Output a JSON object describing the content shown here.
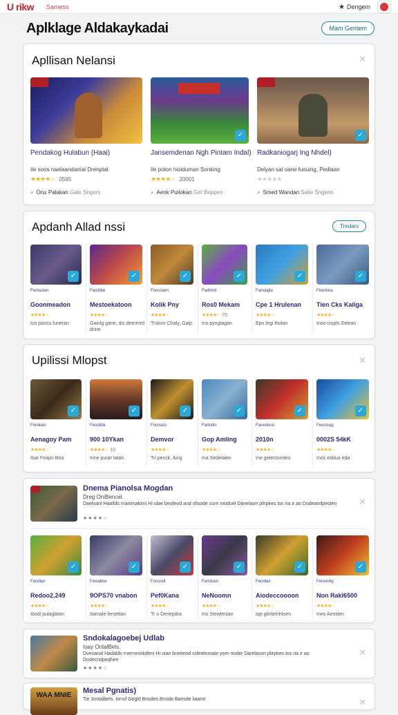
{
  "topbar": {
    "logo": "U rikw",
    "nav": "Samess",
    "user_label": "Dengem"
  },
  "header": {
    "title": "Aplklage Aldakaykadai",
    "button": "Mam Gentem"
  },
  "section1": {
    "title": "Apllisan Nelansi",
    "items": [
      {
        "title": "Pendakog Hulabun (Haai)",
        "desc": "Ile soos naelaandamal Drenptal.",
        "stars": "★★★★☆",
        "meta": "0595",
        "link": "Onu Palakan",
        "link_meta": "Gale Sngers"
      },
      {
        "title": "Jansemdenan Ngh Pintam Indal)",
        "desc": "Ile poton hiolduman Sonking",
        "stars": "★★★★☆",
        "meta": "20001",
        "link": "Aenk Puiiokan",
        "link_meta": "Get Boppen"
      },
      {
        "title": "Radkaniogarj Ing Nhdel)",
        "desc": "Delyan sal oane fuouing, Pedlaan",
        "stars": "★★★★★",
        "meta": "",
        "link": "Smed Wandan",
        "link_meta": "Salie Sngens"
      }
    ]
  },
  "section2": {
    "title": "Apdanh Allad nssi",
    "pill": "Tredani",
    "items": [
      {
        "cat": "Fenlasian",
        "title": "Goonmeadon",
        "stars": "★★★★☆",
        "meta": "",
        "desc": "Ios paosu funeran"
      },
      {
        "cat": "Fandrbe",
        "title": "Mestoekatoon",
        "stars": "★★★★☆",
        "meta": "",
        "desc": "Gainlg gane, dis deerrnrd drine"
      },
      {
        "cat": "Fonvslam",
        "title": "Kolik Pny",
        "stars": "★★★★☆",
        "meta": "",
        "desc": "Trulonr Chaly, Gaip"
      },
      {
        "cat": "Fadtimit",
        "title": "Ros0 Mekam",
        "stars": "★★★★☆",
        "meta": "70",
        "desc": "Ins pyngtagan"
      },
      {
        "cat": "Famaigla",
        "title": "Cpe 1 Hrulenan",
        "stars": "★★★★☆",
        "meta": "",
        "desc": "Epo legi tholan"
      },
      {
        "cat": "Fearlnoa",
        "title": "Tien Cks Kailga",
        "stars": "★★★★☆",
        "meta": "",
        "desc": "Inos-ciopls Selean"
      }
    ]
  },
  "section3": {
    "title": "Upilissi Mlopst",
    "items": [
      {
        "cat": "Fonikian",
        "title": "Aenagoy Pam",
        "stars": "★★★★☆",
        "meta": "",
        "desc": "Ibar Feapn Bea"
      },
      {
        "cat": "Fendiibk",
        "title": "900 10Ykan",
        "stars": "★★★★☆",
        "meta": "10",
        "desc": "Irine purar tatan"
      },
      {
        "cat": "Fonvsen",
        "title": "Demvor",
        "stars": "★★★★☆",
        "meta": "",
        "desc": "Tri pecck, Aing"
      },
      {
        "cat": "Farbldin",
        "title": "Gop Amling",
        "stars": "★★★★☆",
        "meta": "",
        "desc": "Ina Sedelalen"
      },
      {
        "cat": "Fanedonn",
        "title": "2010n",
        "stars": "★★★★☆",
        "meta": "",
        "desc": "Ine getectorotes"
      },
      {
        "cat": "Fenslnag",
        "title": "0002S 54kK",
        "stars": "★★★★☆",
        "meta": "",
        "desc": "Inos eddua eda"
      }
    ]
  },
  "section4": {
    "feature": {
      "title": "Dnema Pianolsa Mogdan",
      "sub": "Dreg OniBencel.",
      "desc": "Daeloanl Haallds manimakimi Hi ulae beufeod and sfisode surn moduel Danelaon plirpkes tos ria ir ao Dodeandpesten",
      "stars": "★★★★☆"
    },
    "items": [
      {
        "cat": "Fendlan",
        "title": "Redoo2.249",
        "stars": "★★★★☆",
        "meta": "",
        "desc": "Ibodi pulaglaion"
      },
      {
        "cat": "Fewabne",
        "title": "9OPS70 vnabon",
        "stars": "★★★★☆",
        "meta": "",
        "desc": "Itarnale fersetlan"
      },
      {
        "cat": "Fonsrelt",
        "title": "Pef0Kana",
        "stars": "★★★★☆",
        "meta": "",
        "desc": "Tr o Derlepdra"
      },
      {
        "cat": "Fertdoan",
        "title": "NeNoomn",
        "stars": "★★★★☆",
        "meta": "",
        "desc": "Ins Stewlenlan"
      },
      {
        "cat": "Fendlan",
        "title": "Aiodeccoooon",
        "stars": "★★★★☆",
        "meta": "",
        "desc": "Iqe glinteinhloen"
      },
      {
        "cat": "Fenemlig",
        "title": "Non Rakl6500",
        "stars": "★★★★☆",
        "meta": "",
        "desc": "Ines Aemlien"
      }
    ]
  },
  "section5": {
    "feature": {
      "title": "Sndokalagoebej Udlab",
      "sub": "Ioay OntalBels.",
      "desc": "Dvesanal Hadalds rnermninkdtrni Hi uiae bneiteod ssfeetnmate yorn mobe Darelason plirpkes tos ria ir ao Dodecndpeqhen",
      "stars": "★★★★☆"
    }
  },
  "section6": {
    "feature": {
      "title": "Mesal Pgnatis)",
      "sub": "Tie 3ontalbels. Iornd Gegld Bnsdes Bnsda Bansde liaamt",
      "thumb_text": "WAA MNIE"
    }
  },
  "colors": {
    "accent": "#1a8a9a",
    "brand": "#d0202a",
    "title_text": "#2b2b7a",
    "star": "#f0b020",
    "check": "#2aa8d8"
  }
}
